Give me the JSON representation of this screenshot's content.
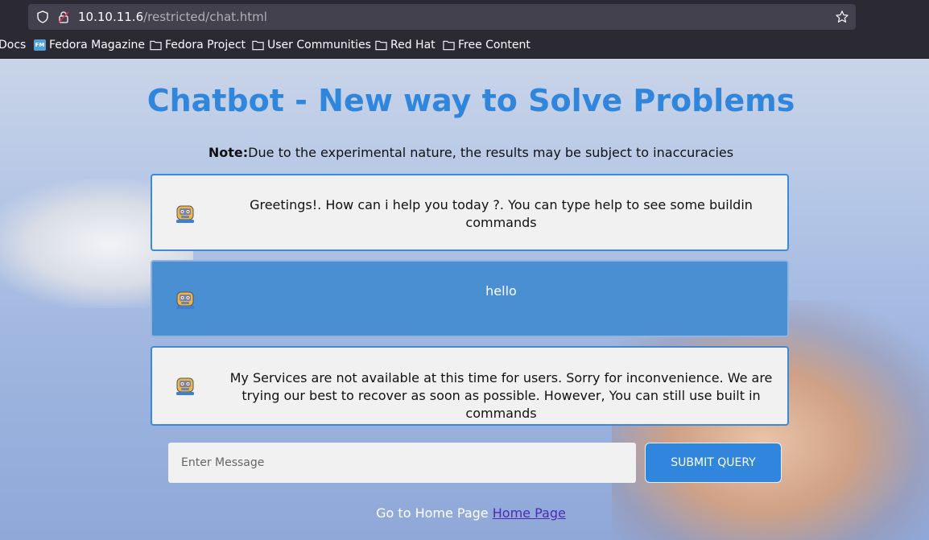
{
  "browser": {
    "url_host": "10.10.11.6",
    "url_path": "/restricted/chat.html",
    "bookmarks": [
      "Docs",
      "Fedora Magazine",
      "Fedora Project",
      "User Communities",
      "Red Hat",
      "Free Content"
    ],
    "fm_badge": "FM"
  },
  "page": {
    "title": "Chatbot - New way to Solve Problems",
    "note_label": "Note:",
    "note_text": "Due to the experimental nature, the results may be subject to inaccuracies",
    "messages": [
      {
        "role": "bot",
        "text": "Greetings!. How can i help you today ?. You can type help to see some buildin commands"
      },
      {
        "role": "user",
        "text": "hello"
      },
      {
        "role": "bot",
        "text": "My Services are not available at this time for users. Sorry for inconvenience. We are trying our best to recover as soon as possible. However, You can still use built in commands"
      }
    ],
    "input_placeholder": "Enter Message",
    "input_value": "",
    "submit_label": "SUBMIT QUERY",
    "footer_text": "Go to Home Page",
    "footer_link": "Home Page"
  },
  "colors": {
    "title": "#2f86dc",
    "user_bubble": "#4b8fd3",
    "bot_bubble": "#f1f1f1",
    "submit": "#2f86dc"
  }
}
